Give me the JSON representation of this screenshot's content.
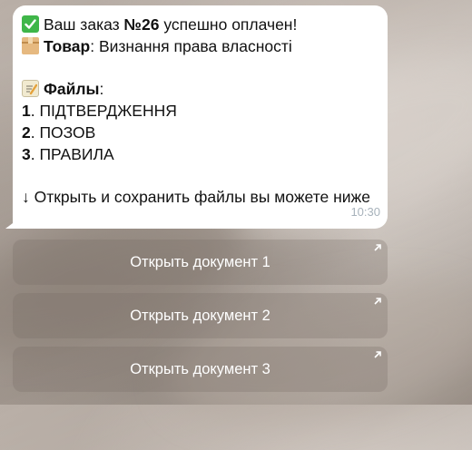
{
  "message": {
    "line1_prefix": "Ваш заказ ",
    "order_number": "№26",
    "line1_suffix": " успешно оплачен!",
    "product_label": "Товар",
    "product_value": ": Визнання права власності",
    "files_label": "Файлы",
    "files_colon": ":",
    "files": [
      {
        "num": "1",
        "name": ". ПІДТВЕРДЖЕННЯ"
      },
      {
        "num": "2",
        "name": ". ПОЗОВ"
      },
      {
        "num": "3",
        "name": ". ПРАВИЛА"
      }
    ],
    "footer_text": "↓ Открыть и сохранить файлы вы можете ниже",
    "time": "10:30",
    "icons": [
      "check-mark-icon",
      "package-icon",
      "memo-icon"
    ]
  },
  "keyboard": {
    "buttons": [
      {
        "label": "Открыть документ 1"
      },
      {
        "label": "Открыть документ 2"
      },
      {
        "label": "Открыть документ 3"
      }
    ]
  }
}
